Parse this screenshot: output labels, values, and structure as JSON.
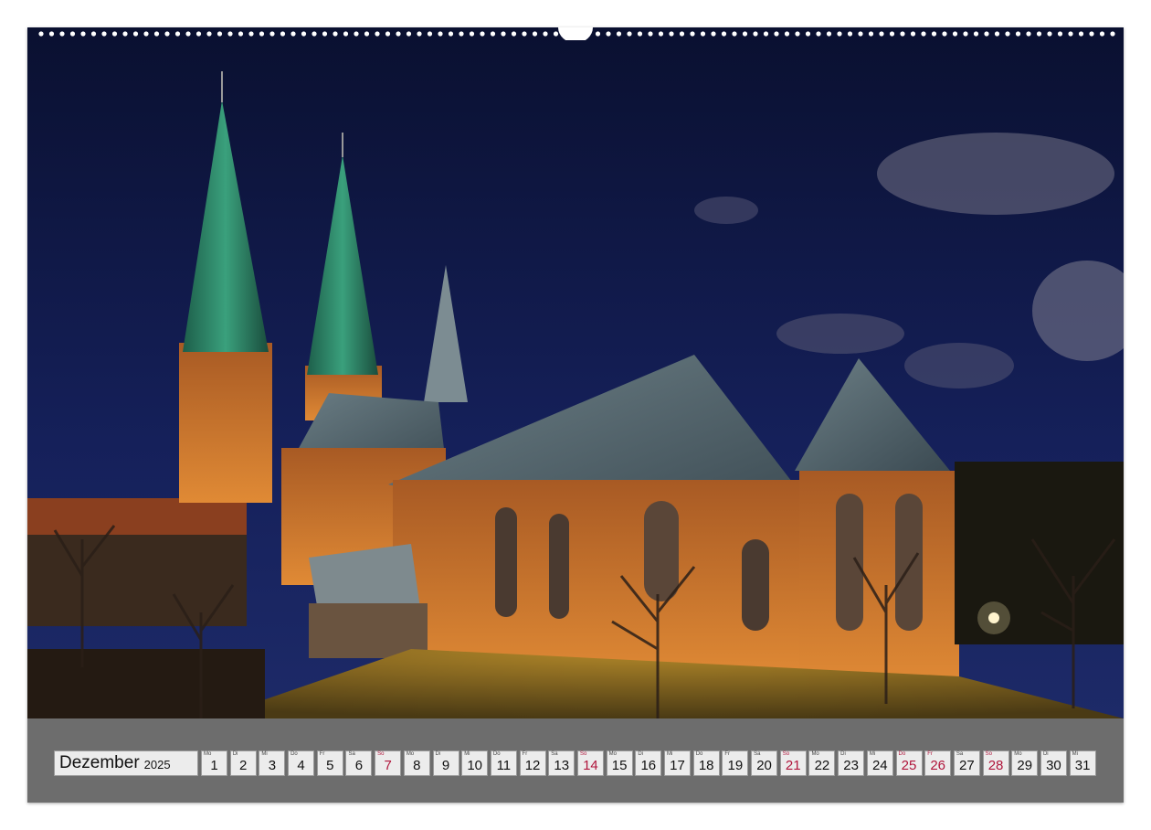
{
  "calendar": {
    "month": "Dezember",
    "year": "2025",
    "days": [
      {
        "wd": "Mo",
        "n": "1",
        "sun": false
      },
      {
        "wd": "Di",
        "n": "2",
        "sun": false
      },
      {
        "wd": "Mi",
        "n": "3",
        "sun": false
      },
      {
        "wd": "Do",
        "n": "4",
        "sun": false
      },
      {
        "wd": "Fr",
        "n": "5",
        "sun": false
      },
      {
        "wd": "Sa",
        "n": "6",
        "sun": false
      },
      {
        "wd": "So",
        "n": "7",
        "sun": true
      },
      {
        "wd": "Mo",
        "n": "8",
        "sun": false
      },
      {
        "wd": "Di",
        "n": "9",
        "sun": false
      },
      {
        "wd": "Mi",
        "n": "10",
        "sun": false
      },
      {
        "wd": "Do",
        "n": "11",
        "sun": false
      },
      {
        "wd": "Fr",
        "n": "12",
        "sun": false
      },
      {
        "wd": "Sa",
        "n": "13",
        "sun": false
      },
      {
        "wd": "So",
        "n": "14",
        "sun": true
      },
      {
        "wd": "Mo",
        "n": "15",
        "sun": false
      },
      {
        "wd": "Di",
        "n": "16",
        "sun": false
      },
      {
        "wd": "Mi",
        "n": "17",
        "sun": false
      },
      {
        "wd": "Do",
        "n": "18",
        "sun": false
      },
      {
        "wd": "Fr",
        "n": "19",
        "sun": false
      },
      {
        "wd": "Sa",
        "n": "20",
        "sun": false
      },
      {
        "wd": "So",
        "n": "21",
        "sun": true
      },
      {
        "wd": "Mo",
        "n": "22",
        "sun": false
      },
      {
        "wd": "Di",
        "n": "23",
        "sun": false
      },
      {
        "wd": "Mi",
        "n": "24",
        "sun": false
      },
      {
        "wd": "Do",
        "n": "25",
        "sun": true
      },
      {
        "wd": "Fr",
        "n": "26",
        "sun": true
      },
      {
        "wd": "Sa",
        "n": "27",
        "sun": false
      },
      {
        "wd": "So",
        "n": "28",
        "sun": true
      },
      {
        "wd": "Mo",
        "n": "29",
        "sun": false
      },
      {
        "wd": "Di",
        "n": "30",
        "sun": false
      },
      {
        "wd": "Mi",
        "n": "31",
        "sun": false
      }
    ]
  },
  "colors": {
    "sky": "#0d1638",
    "strip": "#6d6d6d",
    "holiday": "#b0153b",
    "copper_spire": "#2f8a6a",
    "brick": "#c0702a"
  }
}
